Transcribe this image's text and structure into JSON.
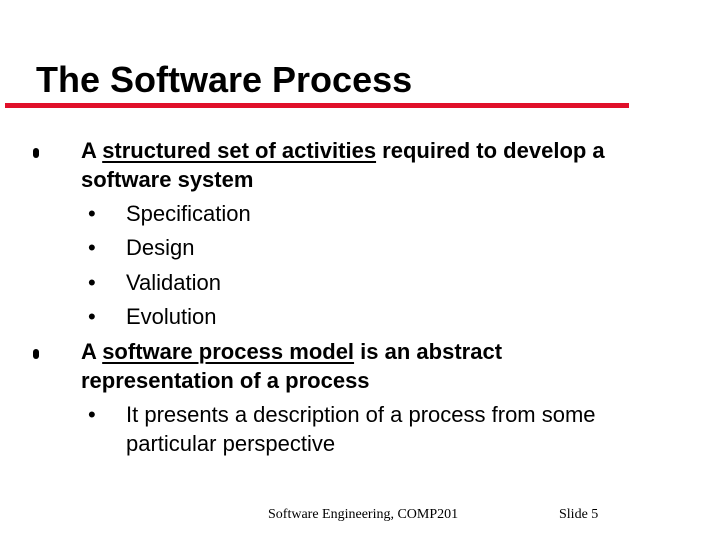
{
  "title": "The Software Process",
  "colors": {
    "title_rule": "#e0102a",
    "text": "#000000",
    "background": "#ffffff"
  },
  "bullet_icon": "filled-dot-icon",
  "sub_bullet_glyph": "•",
  "items": [
    {
      "line1_prefix": "A ",
      "line1_term": "structured set of activities",
      "line1_suffix": " required to develop a",
      "line2": "software system",
      "subitems": [
        "Specification",
        "Design",
        "Validation",
        "Evolution"
      ]
    },
    {
      "line1_prefix": "A ",
      "line1_term": "software process model",
      "line1_suffix": " is an abstract",
      "line2": "representation of a process",
      "subitems": [
        {
          "line1": "It presents a description of a process from some",
          "line2": "particular perspective"
        }
      ]
    }
  ],
  "footer": {
    "course": "Software Engineering, COMP201",
    "slide_label": "Slide  5"
  }
}
